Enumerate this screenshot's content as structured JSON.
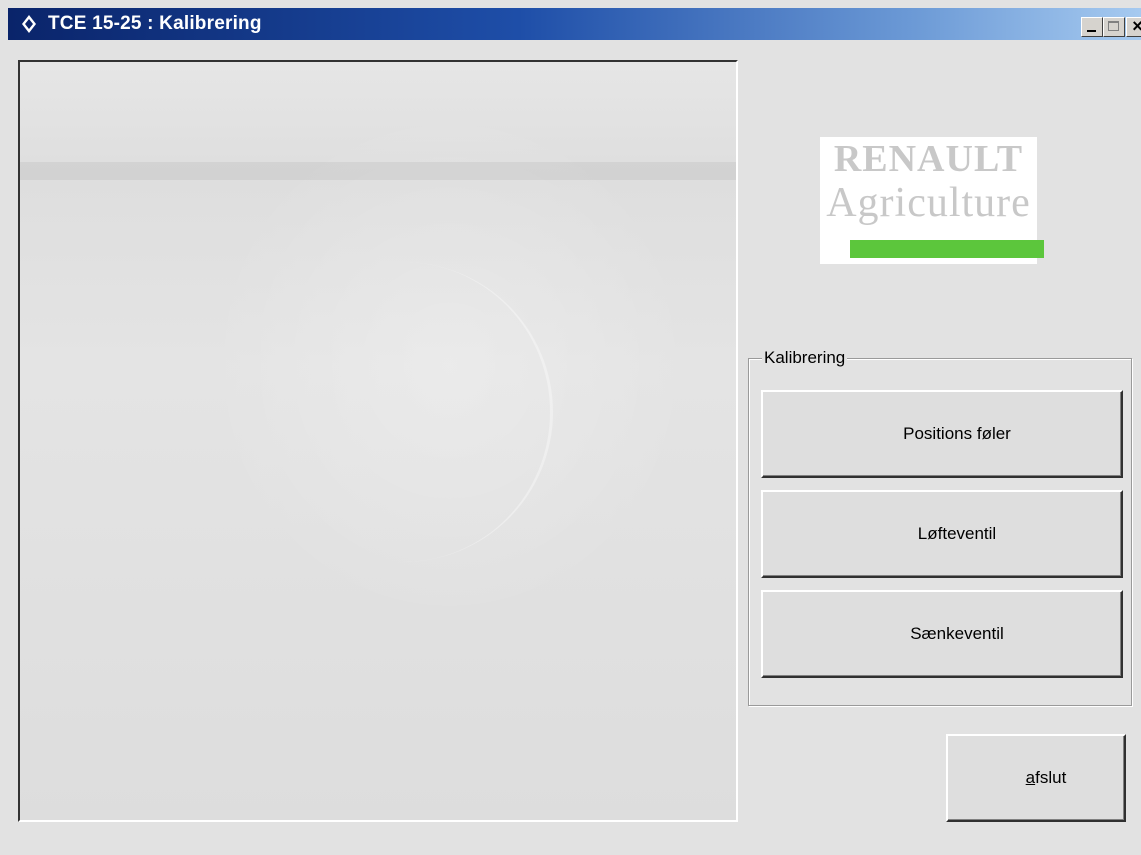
{
  "window": {
    "title": "TCE 15-25 : Kalibrering",
    "controls": [
      "minimize",
      "maximize",
      "close"
    ],
    "close_glyph": "×"
  },
  "logo": {
    "line1": "RENAULT",
    "line2": "Agriculture",
    "bar_color": "#5cc63c"
  },
  "calibration_group": {
    "legend": "Kalibrering",
    "buttons": [
      {
        "label": "Positions føler"
      },
      {
        "label": "Løfteventil"
      },
      {
        "label": "Sænkeventil"
      }
    ]
  },
  "exit_button": {
    "mnemonic": "a",
    "label_rest": "fslut"
  },
  "colors": {
    "titlebar_start": "#0a246a",
    "titlebar_end": "#a6caf0",
    "face": "#e2e2e2"
  }
}
